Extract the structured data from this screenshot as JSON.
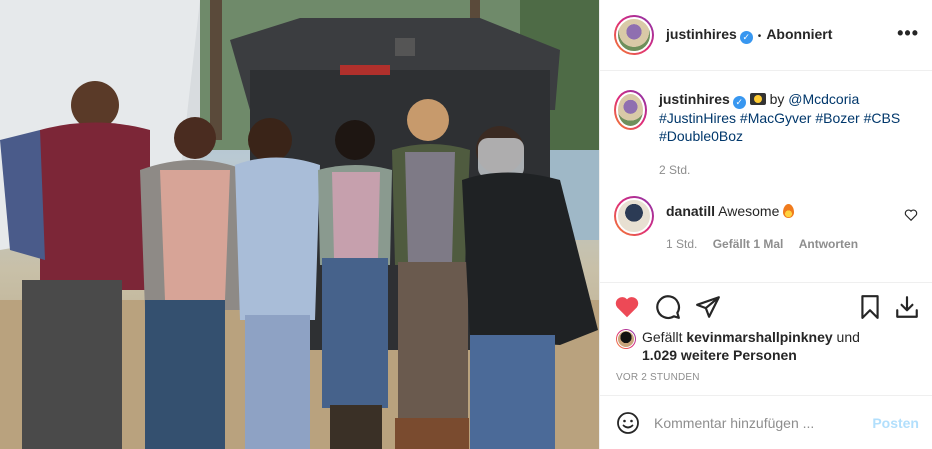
{
  "post": {
    "username": "justinhires",
    "verified_glyph": "✓",
    "separator": "•",
    "follow_status": "Abonniert",
    "more_glyph": "•••"
  },
  "caption": {
    "username": "justinhires",
    "by_text": "by",
    "mention": "@Mcdcoria",
    "hashtags": "#JustinHires #MacGyver #Bozer #CBS #Double0Boz",
    "age": "2 Std."
  },
  "comment": {
    "username": "danatill",
    "text": "Awesome",
    "age": "1 Std.",
    "likes": "Gefällt 1 Mal",
    "reply": "Antworten"
  },
  "likes": {
    "prefix": "Gefällt",
    "user": "kevinmarshallpinkney",
    "suffix": "und",
    "others": "1.029 weitere Personen"
  },
  "timestamp": "VOR 2 STUNDEN",
  "composer": {
    "placeholder": "Kommentar hinzufügen ...",
    "post_label": "Posten"
  },
  "icons": [
    "heart-icon",
    "comment-icon",
    "share-icon",
    "bookmark-icon",
    "download-icon",
    "emoji-icon",
    "camera-icon",
    "fire-icon",
    "verified-badge-icon",
    "more-options-icon"
  ],
  "colors": {
    "like_red": "#ed4956",
    "link_blue": "#00376b",
    "post_disabled": "#b2dffc",
    "verified": "#3897f0"
  }
}
